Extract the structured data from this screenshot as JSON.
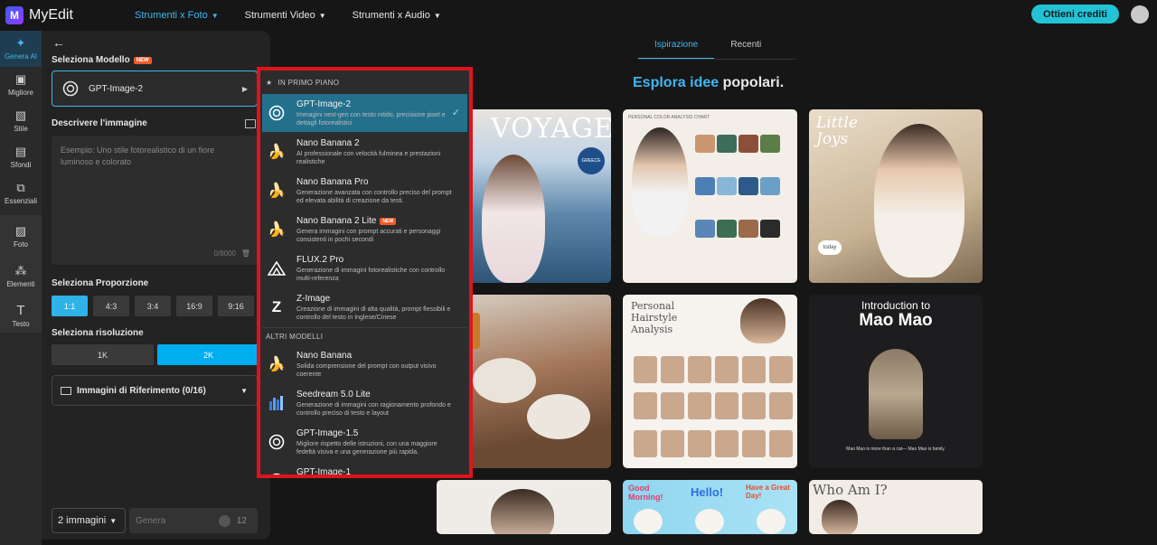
{
  "brand": {
    "name": "MyEdit",
    "mark": "M"
  },
  "nav": [
    {
      "label": "Strumenti x Foto",
      "active": true
    },
    {
      "label": "Strumenti Video",
      "active": false
    },
    {
      "label": "Strumenti x Audio",
      "active": false
    }
  ],
  "header": {
    "credits_label": "Ottieni crediti"
  },
  "rail": [
    {
      "label": "Genera AI",
      "icon": "wand-icon",
      "active": true
    },
    {
      "label": "Migliore",
      "icon": "image-icon",
      "active": false
    },
    {
      "label": "Stile",
      "icon": "style-icon",
      "active": false
    },
    {
      "label": "Sfondi",
      "icon": "background-icon",
      "active": false
    },
    {
      "label": "Essenziali",
      "icon": "crop-icon",
      "active": false
    },
    {
      "label": "Foto",
      "icon": "photo-icon",
      "active": false
    },
    {
      "label": "Elementi",
      "icon": "elements-icon",
      "active": false
    },
    {
      "label": "Testo",
      "icon": "text-icon",
      "active": false
    }
  ],
  "panel": {
    "model_label": "Seleziona Modello",
    "new_badge": "NEW",
    "selected_model": "GPT-Image-2",
    "describe_label": "Descrivere l'immagine",
    "prompt_placeholder": "Esempio: Uno stile fotorealistico di un fiore luminoso e colorato",
    "prompt_counter": "0/8000",
    "ratio_label": "Seleziona Proporzione",
    "ratios": [
      "1:1",
      "4:3",
      "3:4",
      "16:9",
      "9:16"
    ],
    "selected_ratio": "1:1",
    "resolution_label": "Seleziona risoluzione",
    "resolutions": [
      "1K",
      "2K"
    ],
    "selected_resolution": "2K",
    "reference_label": "Immagini di Riferimento (0/16)",
    "count_value": "2 immagini",
    "generate_label": "Genera",
    "generate_cost": "12"
  },
  "dropdown": {
    "featured_label": "IN PRIMO PIANO",
    "other_label": "ALTRI MODELLI",
    "featured": [
      {
        "name": "GPT-Image-2",
        "desc": "Immagini next-gen con testo nitido, precisione pixel e dettagli fotorealistici",
        "icon": "openai-icon",
        "selected": true,
        "new": false
      },
      {
        "name": "Nano Banana 2",
        "desc": "AI professionale con velocità fulminea e prestazioni realistiche",
        "icon": "banana-icon",
        "selected": false,
        "new": false
      },
      {
        "name": "Nano Banana Pro",
        "desc": "Generazione avanzata con controllo preciso del prompt ed elevata abilità di creazione da testi.",
        "icon": "banana-icon",
        "selected": false,
        "new": false
      },
      {
        "name": "Nano Banana 2 Lite",
        "desc": "Genera immagini con prompt accurati e personaggi consistenti in pochi secondi",
        "icon": "banana-icon",
        "selected": false,
        "new": true
      },
      {
        "name": "FLUX.2 Pro",
        "desc": "Generazione di immagini fotorealistiche con controllo multi-referenza",
        "icon": "flux-icon",
        "selected": false,
        "new": false
      },
      {
        "name": "Z-Image",
        "desc": "Creazione di immagini di alta qualità, prompt flessibili e controllo del testo in Inglese/Cinese",
        "icon": "z-icon",
        "selected": false,
        "new": false
      }
    ],
    "others": [
      {
        "name": "Nano Banana",
        "desc": "Solida comprensione del prompt con output visivo coerente",
        "icon": "banana-icon"
      },
      {
        "name": "Seedream 5.0 Lite",
        "desc": "Generazione di immagini con ragionamento profondo e controllo preciso di testo e layout",
        "icon": "seedream-icon"
      },
      {
        "name": "GPT-Image-1.5",
        "desc": "Migliore rispetto delle istruzioni, con una maggiore fedeltà visiva e una generazione più rapida.",
        "icon": "openai-icon"
      },
      {
        "name": "GPT-Image-1",
        "desc": "",
        "icon": "openai-icon"
      }
    ]
  },
  "main": {
    "tabs": [
      {
        "label": "Ispirazione",
        "active": true
      },
      {
        "label": "Recenti",
        "active": false
      }
    ],
    "title_hl": "Esplora idee",
    "title_rest": " popolari.",
    "cards": {
      "c1_title": "VOYAGE",
      "c1_badge": "GREECE",
      "c2_title": "PERSONAL COLOR ANALYSIS CHART",
      "c3_title": "Little Joys",
      "c3_tag": "today",
      "c5_title": "Personal Hairstyle Analysis",
      "c6_title": "Introduction to",
      "c6_name": "Mao Mao",
      "c6_foot": "Mao Mao is more than a cat— Mao Mao is family.",
      "c8_a": "Good Morning!",
      "c8_b": "Hello!",
      "c8_c": "Have a Great Day!",
      "c9_title": "Who Am I?"
    }
  },
  "colors": {
    "accent": "#3fb6f0",
    "credits": "#23c3d6",
    "highlight_border": "#e0131c",
    "selected_row": "#23708c"
  }
}
